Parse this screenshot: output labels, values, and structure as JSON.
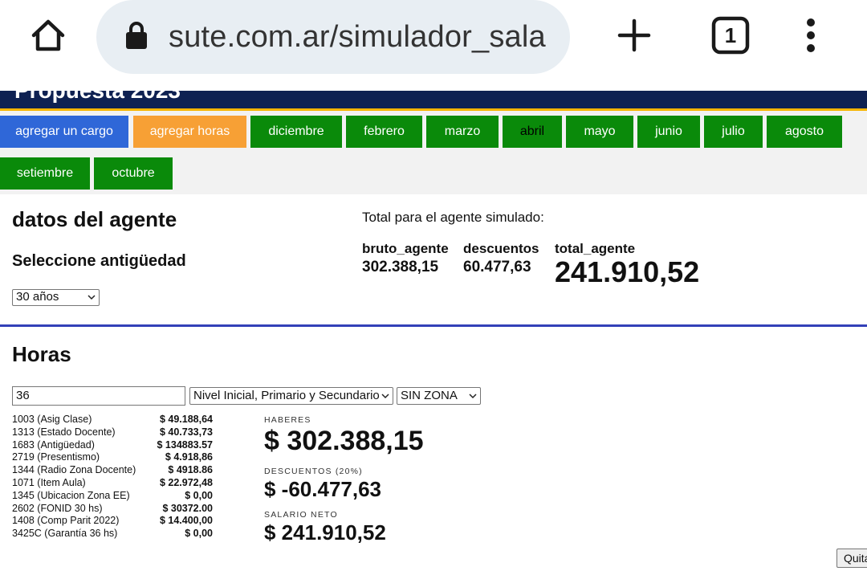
{
  "browser": {
    "url": "sute.com.ar/simulador_sala",
    "tab_count": "1"
  },
  "page": {
    "header_title": "Propuesta 2023"
  },
  "nav_buttons": [
    {
      "label": "agregar un cargo",
      "color": "#2f67d8"
    },
    {
      "label": "agregar horas",
      "color": "#f7a035"
    },
    {
      "label": "diciembre",
      "color": "#0a8a0a"
    },
    {
      "label": "febrero",
      "color": "#0a8a0a"
    },
    {
      "label": "marzo",
      "color": "#0a8a0a"
    },
    {
      "label": "abril",
      "color": "#0a8a0a"
    },
    {
      "label": "mayo",
      "color": "#0a8a0a"
    },
    {
      "label": "junio",
      "color": "#0a8a0a"
    },
    {
      "label": "julio",
      "color": "#0a8a0a"
    },
    {
      "label": "agosto",
      "color": "#0a8a0a"
    },
    {
      "label": "setiembre",
      "color": "#0a8a0a"
    },
    {
      "label": "octubre",
      "color": "#0a8a0a"
    }
  ],
  "agente": {
    "title": "datos del agente",
    "antiguedad_label": "Seleccione antigüedad",
    "antiguedad_value": "30 años",
    "total_label": "Total para el agente simulado:",
    "bruto_label": "bruto_agente",
    "bruto_value": "302.388,15",
    "descuentos_label": "descuentos",
    "descuentos_value": "60.477,63",
    "total_key": "total_agente",
    "total_value": "241.910,52"
  },
  "horas": {
    "title": "Horas",
    "input_value": "36",
    "nivel_value": "Nivel Inicial, Primario y Secundario",
    "zona_value": "SIN ZONA",
    "codes": [
      {
        "name": "1003 (Asig Clase)",
        "amount": "$ 49.188,64"
      },
      {
        "name": "1313 (Estado Docente)",
        "amount": "$ 40.733,73"
      },
      {
        "name": "1683 (Antigüedad)",
        "amount": "$ 134883.57"
      },
      {
        "name": "2719 (Presentismo)",
        "amount": "$ 4.918,86"
      },
      {
        "name": "1344 (Radio Zona Docente)",
        "amount": "$ 4918.86"
      },
      {
        "name": "1071 (Item Aula)",
        "amount": "$ 22.972,48"
      },
      {
        "name": "1345 (Ubicacion Zona EE)",
        "amount": "$ 0,00"
      },
      {
        "name": "2602 (FONID 30 hs)",
        "amount": "$ 30372.00"
      },
      {
        "name": "1408 (Comp Parit 2022)",
        "amount": "$ 14.400,00"
      },
      {
        "name": "3425C (Garantía 36 hs)",
        "amount": "$ 0,00"
      }
    ],
    "haberes_label": "HABERES",
    "haberes_value": "$ 302.388,15",
    "descuentos_label": "DESCUENTOS (20%)",
    "descuentos_value": "$ -60.477,63",
    "neto_label": "SALARIO NETO",
    "neto_value": "$ 241.910,52",
    "quit_label": "Quitar"
  }
}
